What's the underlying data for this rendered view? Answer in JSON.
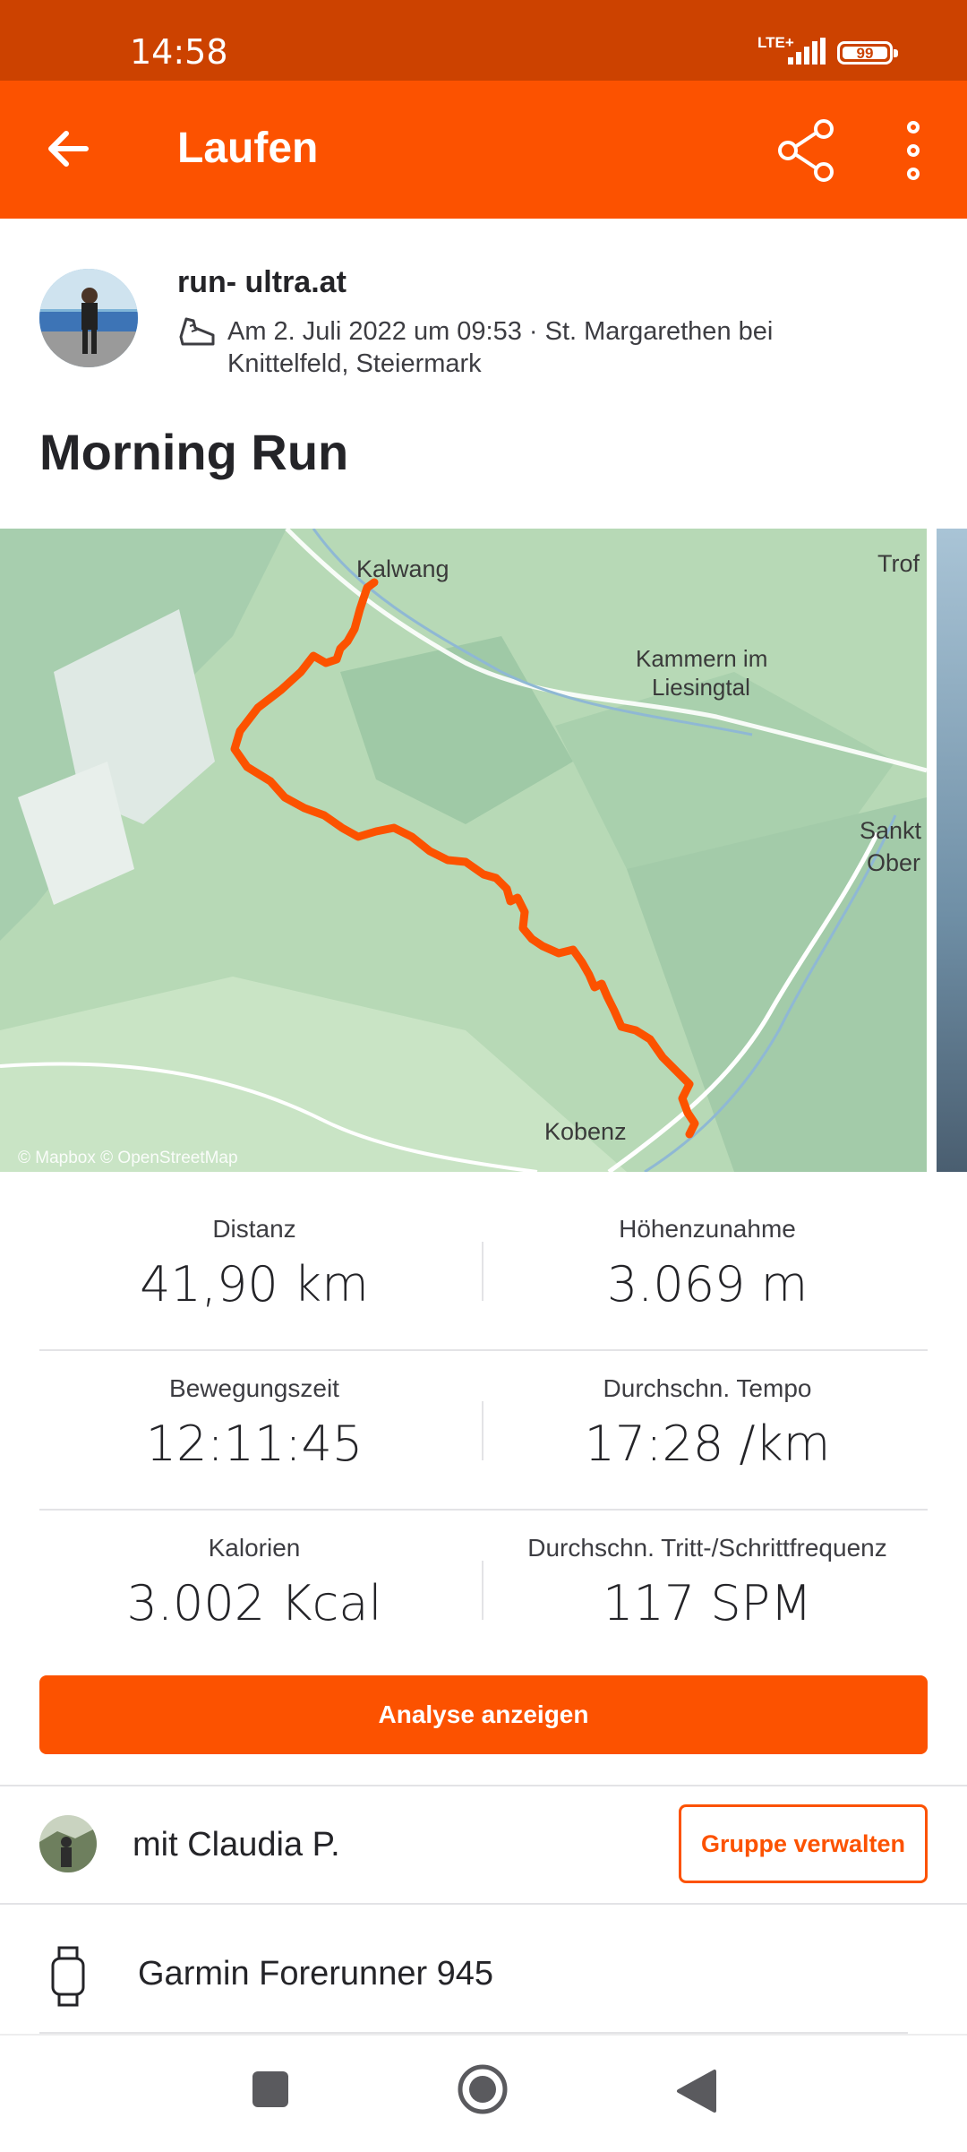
{
  "status": {
    "time": "14:58",
    "network": "LTE+",
    "battery": "99"
  },
  "appbar": {
    "title": "Laufen"
  },
  "activity": {
    "athlete": "run- ultra.at",
    "meta": "Am 2. Juli 2022 um 09:53 · St. Margarethen bei Knittelfeld, Steiermark",
    "title": "Morning Run"
  },
  "map": {
    "labels": {
      "kalwang": "Kalwang",
      "trof": "Trof",
      "kammern1": "Kammern im",
      "kammern2": "Liesingtal",
      "sankt1": "Sankt",
      "sankt2": "Ober",
      "kobenz": "Kobenz"
    },
    "attribution": "© Mapbox © OpenStreetMap",
    "route_color": "#fc5200"
  },
  "stats": [
    {
      "label": "Distanz",
      "value": "41,90 km"
    },
    {
      "label": "Höhenzunahme",
      "value": "3.069 m"
    },
    {
      "label": "Bewegungszeit",
      "value": "12:11:45"
    },
    {
      "label": "Durchschn. Tempo",
      "value": "17:28 /km"
    },
    {
      "label": "Kalorien",
      "value": "3.002 Kcal"
    },
    {
      "label": "Durchschn. Tritt-/Schrittfrequenz",
      "value": "117 SPM"
    }
  ],
  "buttons": {
    "analyse": "Analyse anzeigen",
    "group": "Gruppe verwalten"
  },
  "group": {
    "text": "mit Claudia P."
  },
  "device": {
    "name": "Garmin Forerunner 945"
  },
  "icons": [
    "back-arrow-icon",
    "share-icon",
    "more-vert-icon",
    "shoe-icon",
    "watch-icon"
  ],
  "colors": {
    "accent": "#fc5200",
    "statusbar": "#cc4200"
  }
}
